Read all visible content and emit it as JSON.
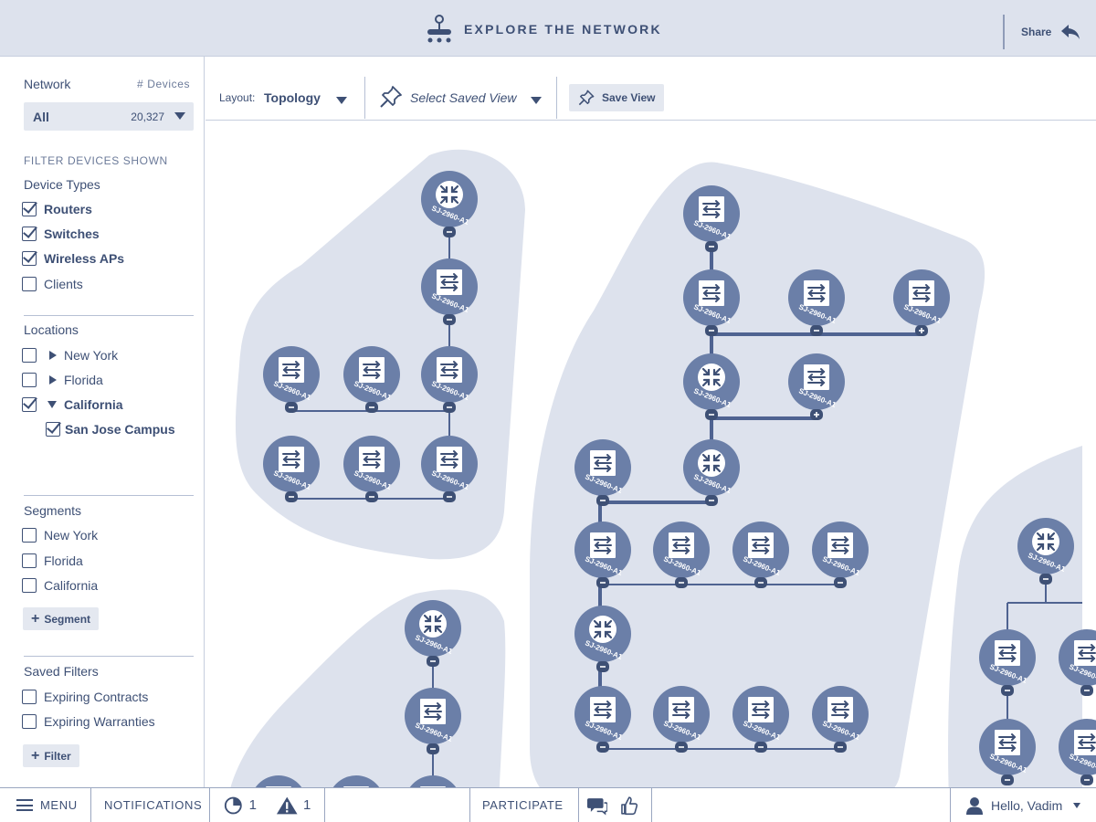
{
  "header": {
    "title": "EXPLORE THE NETWORK",
    "share_label": "Share",
    "icons": {
      "logo": "network-hub-icon",
      "share": "share-arrow-icon"
    }
  },
  "sidebar": {
    "network_label": "Network",
    "devices_label": "# Devices",
    "network_select": {
      "value": "All",
      "count": "20,327"
    },
    "filter_heading": "FILTER DEVICES SHOWN",
    "device_types": {
      "heading": "Device Types",
      "items": [
        {
          "label": "Routers",
          "checked": true
        },
        {
          "label": "Switches",
          "checked": true
        },
        {
          "label": "Wireless APs",
          "checked": true
        },
        {
          "label": "Clients",
          "checked": false
        }
      ]
    },
    "locations": {
      "heading": "Locations",
      "items": [
        {
          "label": "New York",
          "checked": false,
          "expanded": false
        },
        {
          "label": "Florida",
          "checked": false,
          "expanded": false
        },
        {
          "label": "California",
          "checked": true,
          "expanded": true
        },
        {
          "label": "San Jose Campus",
          "checked": true,
          "child": true
        }
      ]
    },
    "segments": {
      "heading": "Segments",
      "items": [
        {
          "label": "New York",
          "checked": false
        },
        {
          "label": "Florida",
          "checked": false
        },
        {
          "label": "California",
          "checked": false
        }
      ],
      "add_label": "Segment"
    },
    "saved_filters": {
      "heading": "Saved Filters",
      "items": [
        {
          "label": "Expiring Contracts",
          "checked": false
        },
        {
          "label": "Expiring Warranties",
          "checked": false
        }
      ],
      "add_label": "Filter"
    }
  },
  "toolbar": {
    "layout_label": "Layout:",
    "layout_value": "Topology",
    "saved_view_placeholder": "Select Saved View",
    "save_view_label": "Save View",
    "icons": {
      "pin": "pushpin-icon"
    }
  },
  "topology": {
    "node_label": "SJ-2960-A1",
    "icons": {
      "router": "router-icon",
      "switch": "switch-icon"
    }
  },
  "footer": {
    "menu_label": "MENU",
    "notifications_label": "NOTIFICATIONS",
    "pie_count": "1",
    "alert_count": "1",
    "participate_label": "PARTICIPATE",
    "user_greeting": "Hello, Vadim",
    "icons": {
      "menu": "hamburger-icon",
      "pie": "pie-chart-icon",
      "alert": "warning-icon",
      "chat": "chat-icon",
      "like": "thumbs-up-icon",
      "user": "user-icon"
    }
  }
}
